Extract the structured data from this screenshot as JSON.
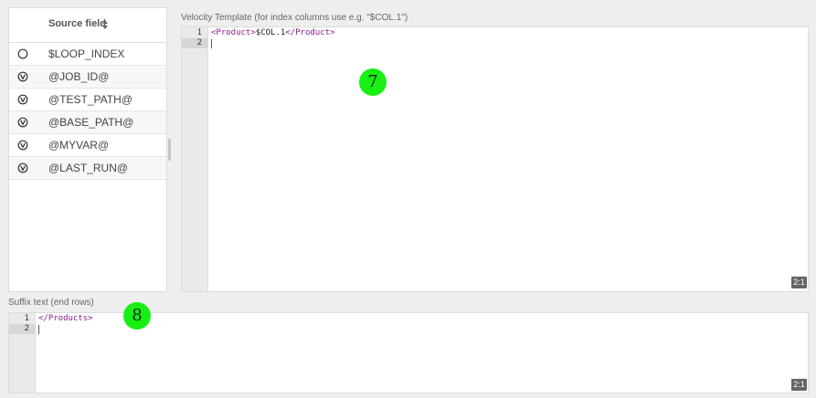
{
  "source_panel": {
    "header_label": "Source field",
    "sort_icon": "sort-updown-icon",
    "rows": [
      {
        "label": "$LOOP_INDEX",
        "icon": "circle-icon"
      },
      {
        "label": "@JOB_ID@",
        "icon": "variable-v-icon"
      },
      {
        "label": "@TEST_PATH@",
        "icon": "variable-v-icon"
      },
      {
        "label": "@BASE_PATH@",
        "icon": "variable-v-icon"
      },
      {
        "label": "@MYVAR@",
        "icon": "variable-v-icon"
      },
      {
        "label": "@LAST_RUN@",
        "icon": "variable-v-icon"
      }
    ]
  },
  "velocity_template": {
    "label": "Velocity Template (for index columns use e.g. \"$COL.1\")",
    "line_numbers": [
      "1",
      "2"
    ],
    "line1": {
      "open_tag": "<Product>",
      "text": "$COL.1",
      "close_tag": "</Product>"
    },
    "ratio": "2:1",
    "marker": "7"
  },
  "suffix_text": {
    "label": "Suffix text (end rows)",
    "line_numbers": [
      "1",
      "2"
    ],
    "line1": {
      "close_tag": "</Products>"
    },
    "ratio": "2:1",
    "marker": "8"
  },
  "colors": {
    "xml_tag": "#8a1c8a",
    "marker_bg": "#19ef14"
  }
}
